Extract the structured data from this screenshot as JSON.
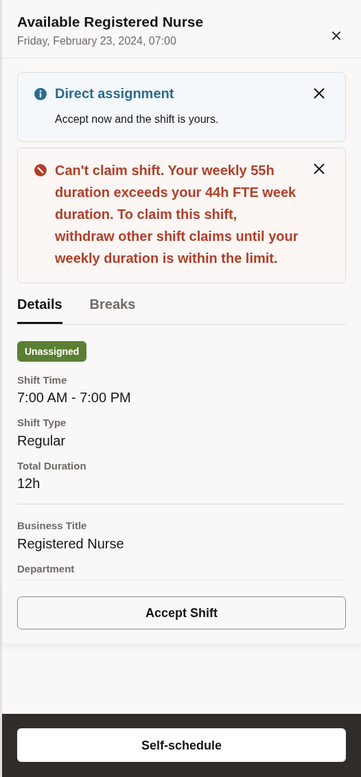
{
  "header": {
    "title": "Available Registered Nurse",
    "subtitle": "Friday, February 23, 2024, 07:00"
  },
  "messages": [
    {
      "kind": "info",
      "title": "Direct assignment",
      "text": "Accept now and the shift is yours."
    },
    {
      "kind": "error",
      "title": "Can't claim shift. Your weekly 55h duration exceeds your 44h FTE week duration. To claim this shift, withdraw other shift claims until your weekly duration is within the limit."
    }
  ],
  "tabs": [
    {
      "label": "Details",
      "selected": true
    },
    {
      "label": "Breaks",
      "selected": false
    }
  ],
  "status_badge": "Unassigned",
  "field_groups": [
    [
      {
        "label": "Shift Time",
        "value": "7:00 AM - 7:00 PM"
      },
      {
        "label": "Shift Type",
        "value": "Regular"
      },
      {
        "label": "Total Duration",
        "value": "12h"
      }
    ],
    [
      {
        "label": "Business Title",
        "value": "Registered Nurse"
      },
      {
        "label": "Department"
      }
    ]
  ],
  "primary_action": "Accept Shift",
  "footer_action": "Self-schedule"
}
